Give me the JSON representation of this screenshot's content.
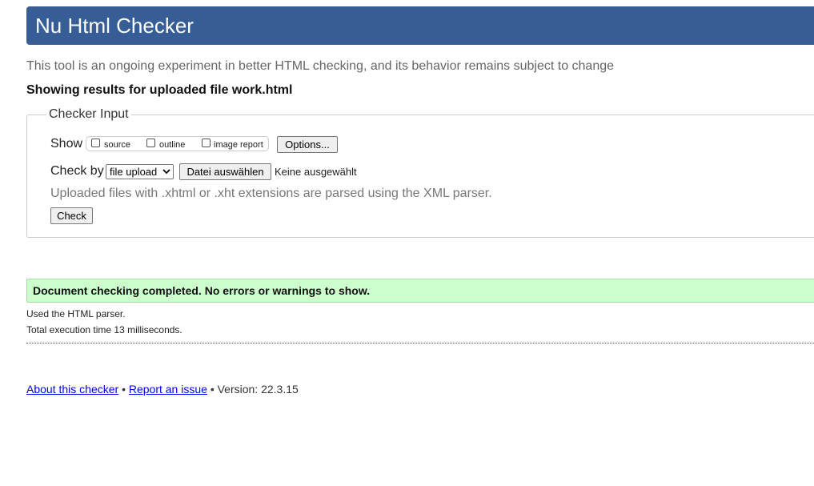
{
  "header": {
    "title": "Nu Html Checker",
    "background_color": "#365d95"
  },
  "tagline": "This tool is an ongoing experiment in better HTML checking, and its behavior remains subject to change",
  "showing_results": "Showing results for uploaded file work.html",
  "checker_input": {
    "legend": "Checker Input",
    "show_label": "Show",
    "show_options": [
      {
        "label": "source",
        "checked": false
      },
      {
        "label": "outline",
        "checked": false
      },
      {
        "label": "image report",
        "checked": false
      }
    ],
    "options_button": "Options...",
    "check_by_label": "Check by",
    "check_by_selected": "file upload",
    "file_button": "Datei auswählen",
    "file_status": "Keine ausgewählt",
    "hint": "Uploaded files with .xhtml or .xht extensions are parsed using the XML parser.",
    "check_button": "Check"
  },
  "result": {
    "message": "Document checking completed. No errors or warnings to show.",
    "success_color": "#ccffcc",
    "parser_info": "Used the HTML parser.",
    "execution_time": "Total execution time 13 milliseconds."
  },
  "footer": {
    "about_link": "About this checker",
    "separator": "•",
    "report_link": "Report an issue",
    "version": "Version: 22.3.15"
  }
}
